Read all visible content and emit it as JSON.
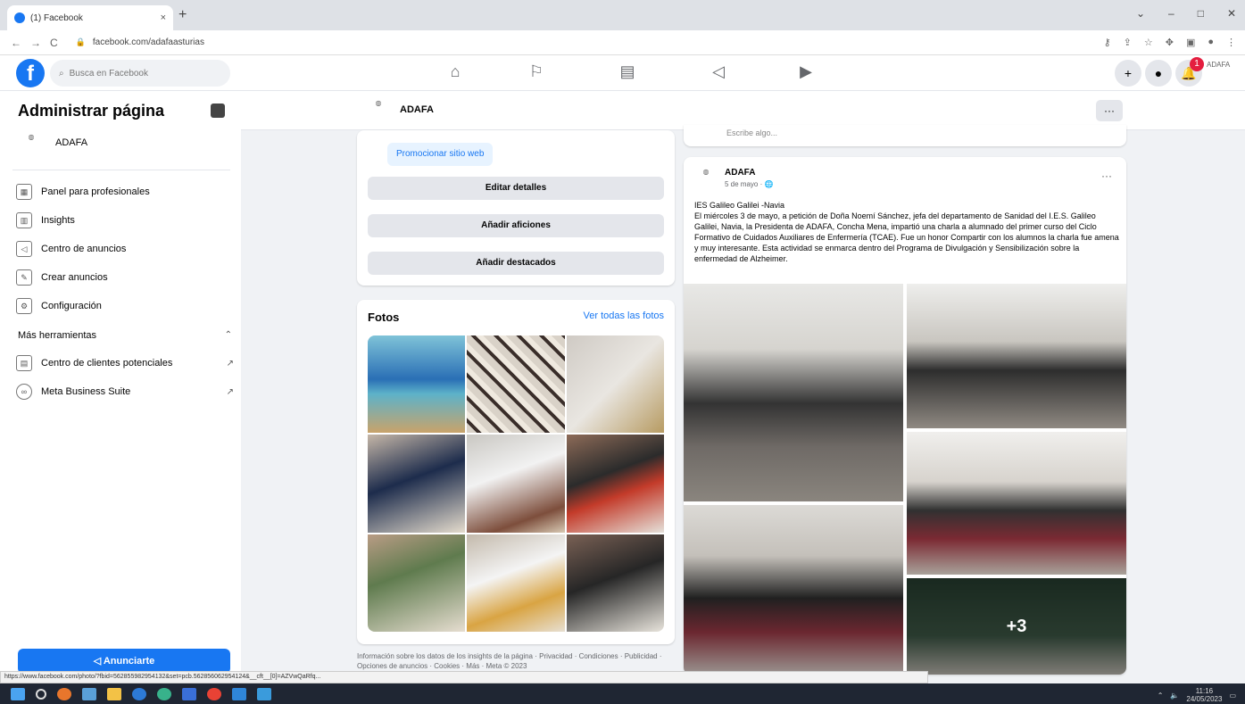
{
  "browser": {
    "tab_title": "(1) Facebook",
    "tab_close": "×",
    "new_tab": "+",
    "url": "facebook.com/adafaasturias",
    "window_controls": [
      "⌄",
      "–",
      "□",
      "✕"
    ]
  },
  "fb_header": {
    "logo": "f",
    "search_placeholder": "Busca en Facebook",
    "notification_count": "1",
    "avatar_caption": "ADAFA"
  },
  "sidebar": {
    "title": "Administrar página",
    "page_name": "ADAFA",
    "items": [
      {
        "label": "Panel para profesionales",
        "icon": "dashboard-icon"
      },
      {
        "label": "Insights",
        "icon": "insights-icon"
      },
      {
        "label": "Centro de anuncios",
        "icon": "megaphone-icon"
      },
      {
        "label": "Crear anuncios",
        "icon": "pencil-icon"
      },
      {
        "label": "Configuración",
        "icon": "gear-icon"
      }
    ],
    "more_tools": "Más herramientas",
    "tools": [
      {
        "label": "Centro de clientes potenciales",
        "icon": "leads-icon",
        "tail": "↗"
      },
      {
        "label": "Meta Business Suite",
        "icon": "meta-icon",
        "tail": "↗"
      }
    ],
    "cta": "Anunciarte"
  },
  "page_header": {
    "name": "ADAFA",
    "more": "···"
  },
  "intro": {
    "promo_label": "Promocionar sitio web",
    "buttons": [
      "Editar detalles",
      "Añadir aficiones",
      "Añadir destacados"
    ]
  },
  "photos": {
    "title": "Fotos",
    "see_all": "Ver todas las fotos"
  },
  "footer": "Información sobre los datos de los insights de la página · Privacidad · Condiciones · Publicidad · Opciones de anuncios · Cookies · Más · Meta © 2023",
  "composer": {
    "placeholder": "Escribe algo..."
  },
  "post": {
    "author": "ADAFA",
    "date": "5 de mayo · 🌐",
    "more": "···",
    "text": "IES Galileo Galilei -Navia\nEl miércoles 3 de mayo, a petición de Doña Noemí Sánchez, jefa del departamento de Sanidad del I.E.S. Galileo Galilei, Navia, la Presidenta de ADAFA, Concha Mena, impartió una charla a alumnado del primer curso del Ciclo Formativo de Cuidados Auxiliares de Enfermería (TCAE). Fue un honor Compartir con los alumnos la charla fue amena y muy interesante. Esta actividad se enmarca dentro del Programa de Divulgación y Sensibilización sobre la enfermedad de Alzheimer.",
    "more_photos": "+3"
  },
  "status_url": "https://www.facebook.com/photo/?fbid=562855982954132&set=pcb.562856062954124&__cft__[0]=AZVwQaRfq...",
  "taskbar": {
    "time": "11:16",
    "date": "24/05/2023"
  }
}
